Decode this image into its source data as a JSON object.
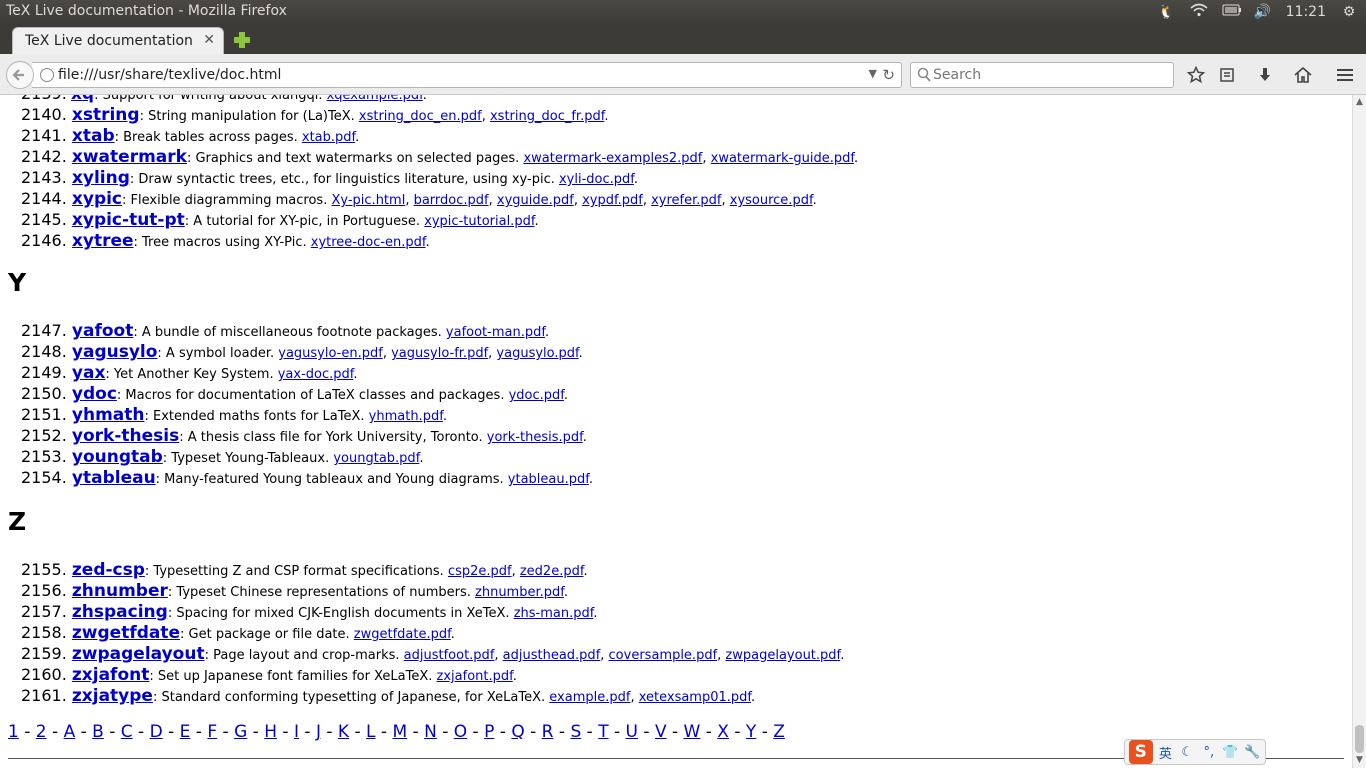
{
  "os": {
    "window_title": "TeX Live documentation - Mozilla Firefox",
    "clock": "11:21"
  },
  "browser": {
    "tab_title": "TeX Live documentation",
    "url": "file:///usr/share/texlive/doc.html",
    "search_placeholder": "Search"
  },
  "sections": {
    "y_heading": "Y",
    "z_heading": "Z"
  },
  "x_entries": [
    {
      "num": "2140.",
      "pkg": "xstring",
      "desc": ": String manipulation for (La)TeX. ",
      "docs": [
        "xstring_doc_en.pdf",
        "xstring_doc_fr.pdf"
      ]
    },
    {
      "num": "2141.",
      "pkg": "xtab",
      "desc": ": Break tables across pages. ",
      "docs": [
        "xtab.pdf"
      ]
    },
    {
      "num": "2142.",
      "pkg": "xwatermark",
      "desc": ": Graphics and text watermarks on selected pages. ",
      "docs": [
        "xwatermark-examples2.pdf",
        "xwatermark-guide.pdf"
      ]
    },
    {
      "num": "2143.",
      "pkg": "xyling",
      "desc": ": Draw syntactic trees, etc., for linguistics literature, using xy-pic. ",
      "docs": [
        "xyli-doc.pdf"
      ]
    },
    {
      "num": "2144.",
      "pkg": "xypic",
      "desc": ": Flexible diagramming macros. ",
      "docs": [
        "Xy-pic.html",
        "barrdoc.pdf",
        "xyguide.pdf",
        "xypdf.pdf",
        "xyrefer.pdf",
        "xysource.pdf"
      ]
    },
    {
      "num": "2145.",
      "pkg": "xypic-tut-pt",
      "desc": ": A tutorial for XY-pic, in Portuguese. ",
      "docs": [
        "xypic-tutorial.pdf"
      ]
    },
    {
      "num": "2146.",
      "pkg": "xytree",
      "desc": ": Tree macros using XY-Pic. ",
      "docs": [
        "xytree-doc-en.pdf"
      ]
    }
  ],
  "y_entries": [
    {
      "num": "2147.",
      "pkg": "yafoot",
      "desc": ": A bundle of miscellaneous footnote packages. ",
      "docs": [
        "yafoot-man.pdf"
      ]
    },
    {
      "num": "2148.",
      "pkg": "yagusylo",
      "desc": ": A symbol loader. ",
      "docs": [
        "yagusylo-en.pdf",
        "yagusylo-fr.pdf",
        "yagusylo.pdf"
      ]
    },
    {
      "num": "2149.",
      "pkg": "yax",
      "desc": ": Yet Another Key System. ",
      "docs": [
        "yax-doc.pdf"
      ]
    },
    {
      "num": "2150.",
      "pkg": "ydoc",
      "desc": ": Macros for documentation of LaTeX classes and packages. ",
      "docs": [
        "ydoc.pdf"
      ]
    },
    {
      "num": "2151.",
      "pkg": "yhmath",
      "desc": ": Extended maths fonts for LaTeX. ",
      "docs": [
        "yhmath.pdf"
      ]
    },
    {
      "num": "2152.",
      "pkg": "york-thesis",
      "desc": ": A thesis class file for York University, Toronto. ",
      "docs": [
        "york-thesis.pdf"
      ]
    },
    {
      "num": "2153.",
      "pkg": "youngtab",
      "desc": ": Typeset Young-Tableaux. ",
      "docs": [
        "youngtab.pdf"
      ]
    },
    {
      "num": "2154.",
      "pkg": "ytableau",
      "desc": ": Many-featured Young tableaux and Young diagrams. ",
      "docs": [
        "ytableau.pdf"
      ]
    }
  ],
  "z_entries": [
    {
      "num": "2155.",
      "pkg": "zed-csp",
      "desc": ": Typesetting Z and CSP format specifications. ",
      "docs": [
        "csp2e.pdf",
        "zed2e.pdf"
      ]
    },
    {
      "num": "2156.",
      "pkg": "zhnumber",
      "desc": ": Typeset Chinese representations of numbers. ",
      "docs": [
        "zhnumber.pdf"
      ]
    },
    {
      "num": "2157.",
      "pkg": "zhspacing",
      "desc": ": Spacing for mixed CJK-English documents in XeTeX. ",
      "docs": [
        "zhs-man.pdf"
      ]
    },
    {
      "num": "2158.",
      "pkg": "zwgetfdate",
      "desc": ": Get package or file date. ",
      "docs": [
        "zwgetfdate.pdf"
      ]
    },
    {
      "num": "2159.",
      "pkg": "zwpagelayout",
      "desc": ": Page layout and crop-marks. ",
      "docs": [
        "adjustfoot.pdf",
        "adjusthead.pdf",
        "coversample.pdf",
        "zwpagelayout.pdf"
      ]
    },
    {
      "num": "2160.",
      "pkg": "zxjafont",
      "desc": ": Set up Japanese font families for XeLaTeX. ",
      "docs": [
        "zxjafont.pdf"
      ]
    },
    {
      "num": "2161.",
      "pkg": "zxjatype",
      "desc": ": Standard conforming typesetting of Japanese, for XeLaTeX. ",
      "docs": [
        "example.pdf",
        "xetexsamp01.pdf"
      ]
    }
  ],
  "letter_nav": [
    "1",
    "2",
    "A",
    "B",
    "C",
    "D",
    "E",
    "F",
    "G",
    "H",
    "I",
    "J",
    "K",
    "L",
    "M",
    "N",
    "O",
    "P",
    "Q",
    "R",
    "S",
    "T",
    "U",
    "V",
    "W",
    "X",
    "Y",
    "Z"
  ],
  "ime": {
    "mode_label": "英"
  }
}
